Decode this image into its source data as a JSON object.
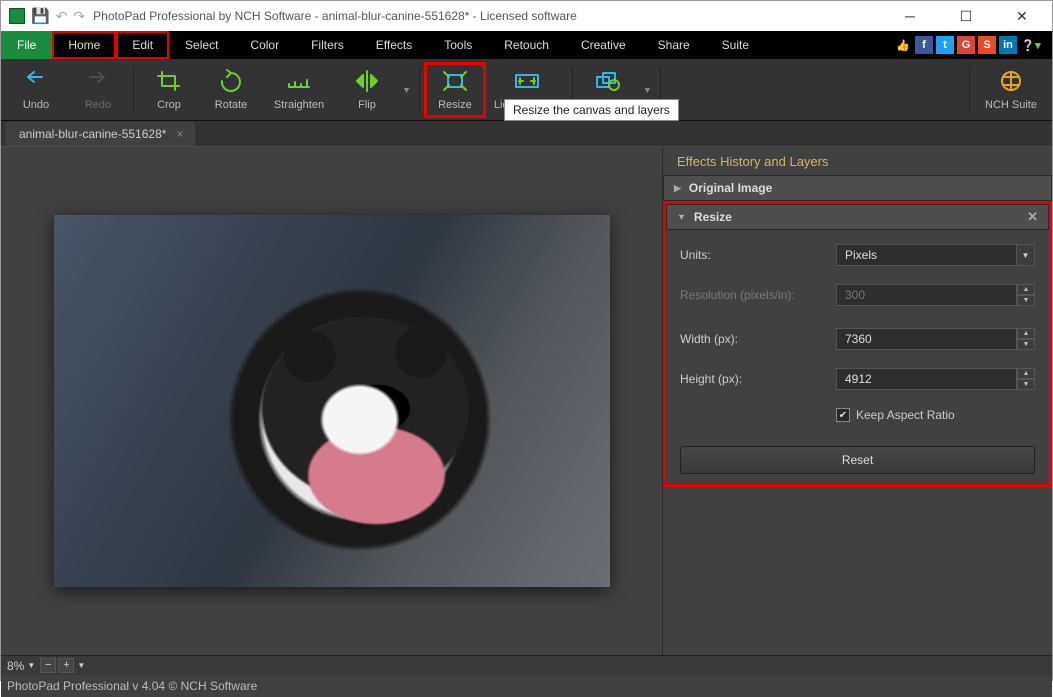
{
  "title": "PhotoPad Professional by NCH Software - animal-blur-canine-551628* - Licensed software",
  "menus": {
    "file": "File",
    "home": "Home",
    "edit": "Edit",
    "select": "Select",
    "color": "Color",
    "filters": "Filters",
    "effects": "Effects",
    "tools": "Tools",
    "retouch": "Retouch",
    "creative": "Creative",
    "share": "Share",
    "suite": "Suite"
  },
  "tools": {
    "undo": "Undo",
    "redo": "Redo",
    "crop": "Crop",
    "rotate": "Rotate",
    "straighten": "Straighten",
    "flip": "Flip",
    "resize": "Resize",
    "liquid": "Liquid Resize",
    "batch": "Batch",
    "nch": "NCH Suite"
  },
  "tooltip": "Resize the canvas and layers",
  "docTab": "animal-blur-canine-551628*",
  "panel": {
    "title": "Effects History and Layers",
    "section1": "Original Image",
    "section2": "Resize",
    "units_label": "Units:",
    "units_value": "Pixels",
    "res_label": "Resolution (pixels/in):",
    "res_value": "300",
    "width_label": "Width (px):",
    "width_value": "7360",
    "height_label": "Height (px):",
    "height_value": "4912",
    "aspect": "Keep Aspect Ratio",
    "reset": "Reset"
  },
  "zoom": "8%",
  "status": "PhotoPad Professional v 4.04 © NCH Software"
}
